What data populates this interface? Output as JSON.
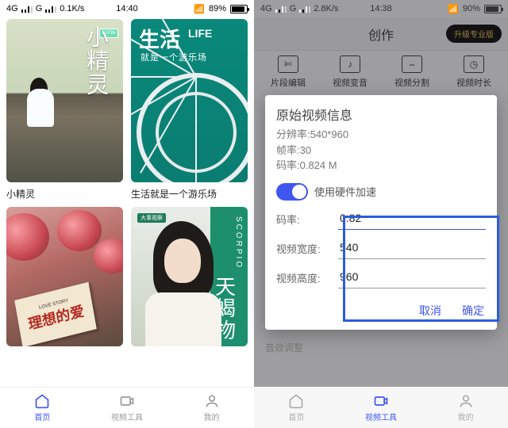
{
  "left": {
    "status": {
      "carrier": "4G",
      "net": "0.1K/s",
      "time": "14:40",
      "battery": "89%"
    },
    "cards": [
      {
        "title": "小精灵",
        "overlay_title": "小精灵",
        "overlay_badge": "ELFIN"
      },
      {
        "title": "生活就是一个游乐场",
        "head": "生活",
        "life": "LIFE",
        "sub": "就是一个游乐场"
      },
      {
        "title": "理想的爱",
        "book": "理想的爱",
        "tag": "LOVE STORY"
      },
      {
        "title": "天蝎物",
        "scorpio": "SCORPIO",
        "cn": "天蝎物",
        "tag": "大事观察"
      }
    ],
    "nav": {
      "home": "首页",
      "tools": "视频工具",
      "mine": "我的"
    }
  },
  "right": {
    "status": {
      "carrier": "4G",
      "net": "2.8K/s",
      "time": "14:38",
      "battery": "90%"
    },
    "header": {
      "title": "创作",
      "upgrade": "升级专业版"
    },
    "tools": [
      {
        "label": "片段编辑"
      },
      {
        "label": "视频变音"
      },
      {
        "label": "视频分割"
      },
      {
        "label": "视频时长"
      }
    ],
    "dialog": {
      "title": "原始视频信息",
      "info_res": "分辨率:540*960",
      "info_fps": "帧率:30",
      "info_bit": "码率:0.824 M",
      "toggle_label": "使用硬件加速",
      "fields": {
        "bitrate_label": "码率:",
        "bitrate_value": "0.82",
        "width_label": "视频宽度:",
        "width_value": "540",
        "height_label": "视频高度:",
        "height_value": "960"
      },
      "cancel": "取消",
      "ok": "确定"
    },
    "below": "音效调整",
    "nav": {
      "home": "首页",
      "tools": "视频工具",
      "mine": "我的"
    }
  }
}
